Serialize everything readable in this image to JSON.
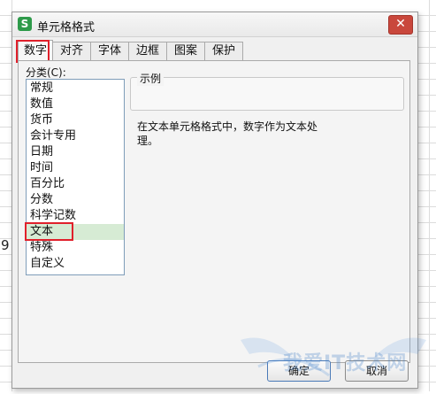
{
  "background": {
    "cell_value": "9"
  },
  "dialog": {
    "app_icon_glyph": "S",
    "title": "单元格格式",
    "close_glyph": "✕",
    "tabs": [
      {
        "label": "数字",
        "active": true
      },
      {
        "label": "对齐"
      },
      {
        "label": "字体"
      },
      {
        "label": "边框"
      },
      {
        "label": "图案"
      },
      {
        "label": "保护"
      }
    ],
    "category_label": "分类(C):",
    "categories": [
      "常规",
      "数值",
      "货币",
      "会计专用",
      "日期",
      "时间",
      "百分比",
      "分数",
      "科学记数",
      "文本",
      "特殊",
      "自定义"
    ],
    "selected_category": "文本",
    "sample_title": "示例",
    "description": "在文本单元格格式中，数字作为文本处\n理。",
    "buttons": {
      "ok": "确定",
      "cancel": "取消"
    }
  },
  "watermark": {
    "text": "我爱IT技术网"
  },
  "colors": {
    "highlight_box": "#e0202b",
    "selected_row": "#d6ebd4",
    "app_icon": "#2e9a4a",
    "close_button": "#c9473c"
  }
}
